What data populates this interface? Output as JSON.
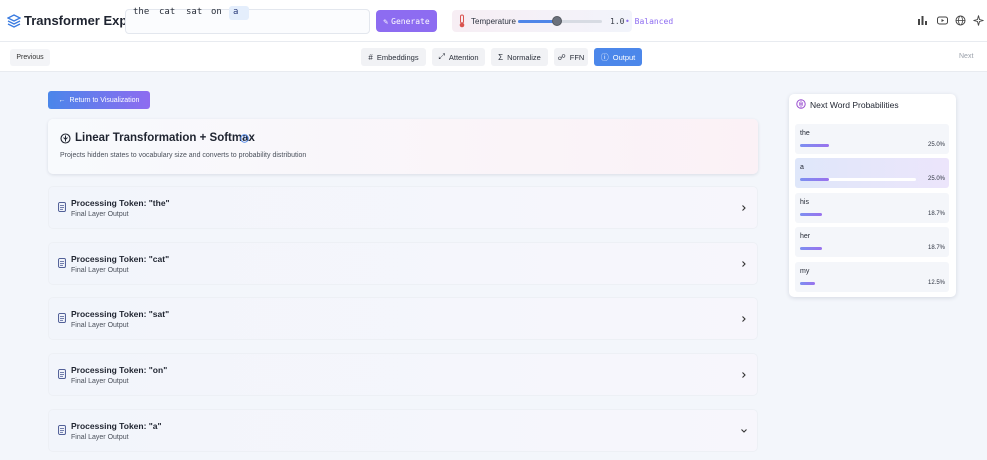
{
  "app": {
    "title": "Transformer Explainer"
  },
  "input": {
    "tokens": [
      "the",
      "cat",
      "sat",
      "on",
      "a"
    ],
    "active_index": 4
  },
  "generate": {
    "label": "Generate"
  },
  "temperature": {
    "label": "Temperature",
    "value": "1.0",
    "mode": "• Balanced",
    "level_fraction": 0.47
  },
  "nav": {
    "previous": "Previous",
    "next": "Next",
    "tabs": [
      {
        "label": "Embeddings",
        "glyph": "#"
      },
      {
        "label": "Attention",
        "glyph": "⤢"
      },
      {
        "label": "Normalize",
        "glyph": "Σ"
      },
      {
        "label": "FFN",
        "glyph": "☍"
      },
      {
        "label": "Output",
        "glyph": "ⓘ"
      }
    ],
    "active_tab": "Output"
  },
  "main": {
    "return_label": "Return to Visualization",
    "section": {
      "title": "Linear Transformation + Softmax",
      "description": "Projects hidden states to vocabulary size and converts to probability distribution"
    },
    "rows": [
      {
        "title": "Processing Token: \"the\"",
        "subtitle": "Final Layer Output",
        "expanded": false
      },
      {
        "title": "Processing Token: \"cat\"",
        "subtitle": "Final Layer Output",
        "expanded": false
      },
      {
        "title": "Processing Token: \"sat\"",
        "subtitle": "Final Layer Output",
        "expanded": false
      },
      {
        "title": "Processing Token: \"on\"",
        "subtitle": "Final Layer Output",
        "expanded": false
      },
      {
        "title": "Processing Token: \"a\"",
        "subtitle": "Final Layer Output",
        "expanded": true
      }
    ]
  },
  "probabilities": {
    "title": "Next Word Probabilities",
    "items": [
      {
        "word": "the",
        "value": "25.0%",
        "fraction": 0.25,
        "selected": false
      },
      {
        "word": "a",
        "value": "25.0%",
        "fraction": 0.25,
        "selected": true
      },
      {
        "word": "his",
        "value": "18.7%",
        "fraction": 0.187,
        "selected": false
      },
      {
        "word": "her",
        "value": "18.7%",
        "fraction": 0.187,
        "selected": false
      },
      {
        "word": "my",
        "value": "12.5%",
        "fraction": 0.125,
        "selected": false
      }
    ]
  },
  "colors": {
    "accent": "#4c87ea",
    "purple": "#8d6cf1"
  }
}
